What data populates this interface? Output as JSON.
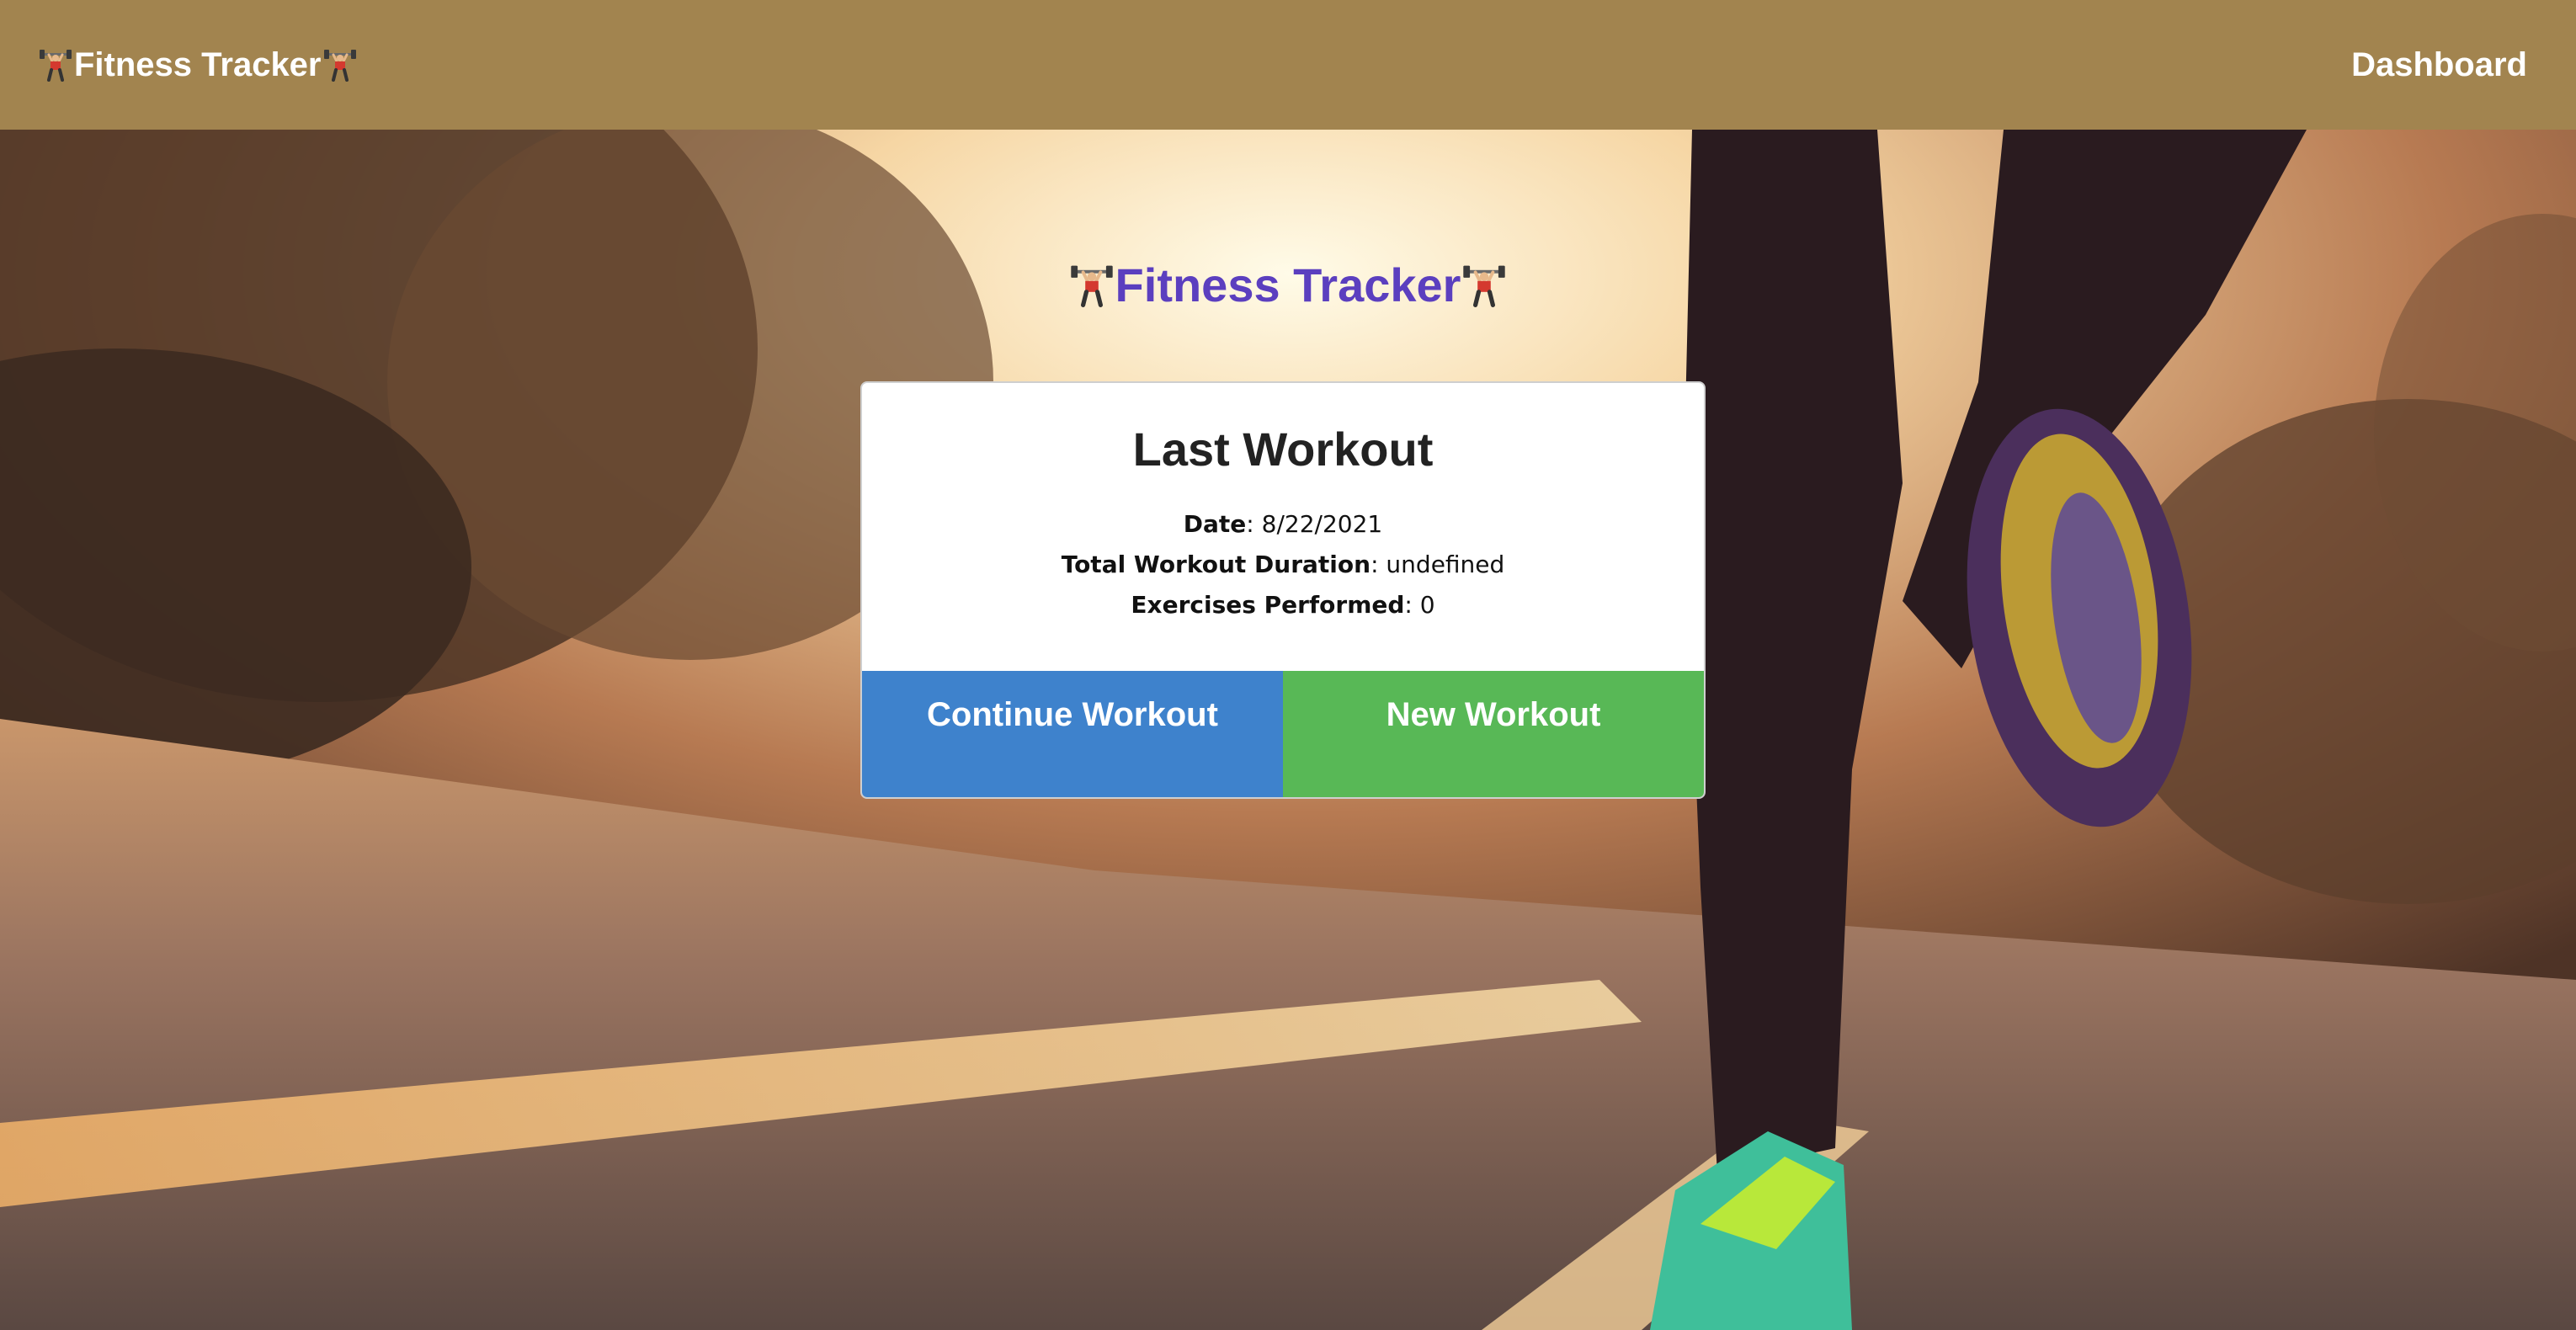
{
  "navbar": {
    "brand": "Fitness Tracker",
    "dashboard_link": "Dashboard"
  },
  "hero": {
    "title": "Fitness Tracker"
  },
  "last_workout": {
    "heading": "Last Workout",
    "date_label": "Date",
    "date_value": "8/22/2021",
    "duration_label": "Total Workout Duration",
    "duration_value": "undefined",
    "exercises_label": "Exercises Performed",
    "exercises_value": "0"
  },
  "actions": {
    "continue_label": "Continue Workout",
    "new_label": "New Workout"
  },
  "icons": {
    "brand_left": "weight-lifter-icon",
    "brand_right": "weight-lifter-icon",
    "title_left": "weight-lifter-icon",
    "title_right": "weight-lifter-icon"
  },
  "colors": {
    "navbar": "#a2844f",
    "title": "#5b3fbf",
    "continue_button": "#3e82cc",
    "new_button": "#58b856"
  }
}
